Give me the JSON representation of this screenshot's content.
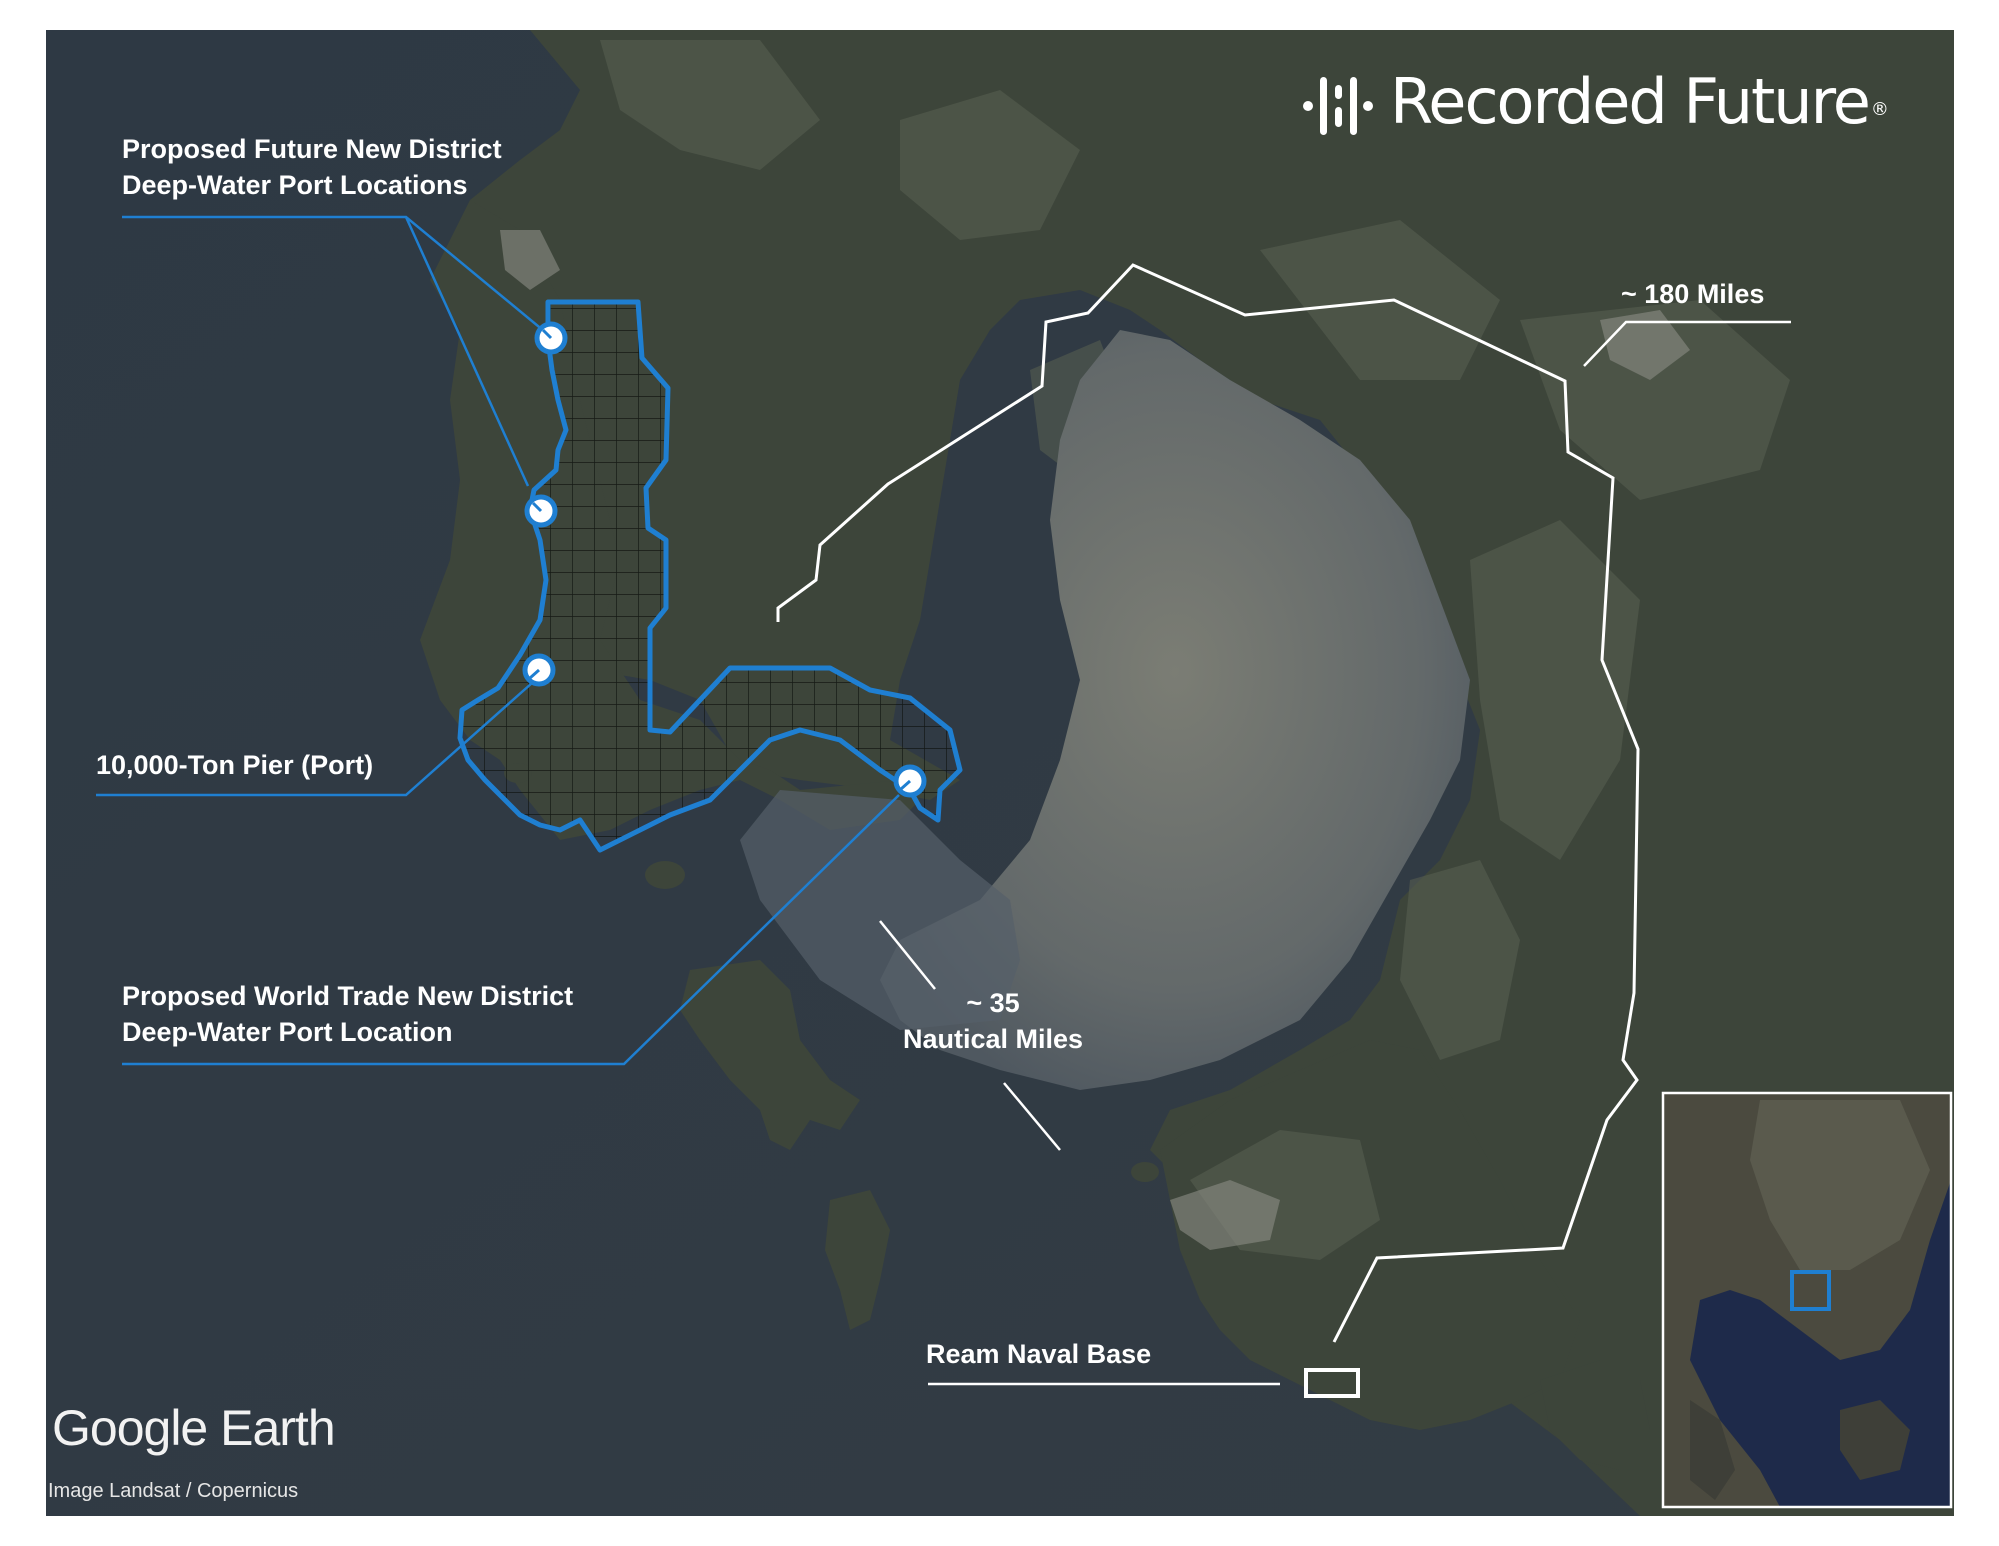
{
  "brand": {
    "name": "Recorded Future",
    "registered_mark": "®"
  },
  "labels": {
    "future_ports": [
      "Proposed Future New District",
      "Deep-Water Port Locations"
    ],
    "pier": "10,000-Ton Pier (Port)",
    "world_trade": [
      "Proposed World Trade New District",
      "Deep-Water Port Location"
    ],
    "distance_nautical": [
      "~ 35",
      "Nautical Miles"
    ],
    "distance_road": "~ 180 Miles",
    "naval_base": "Ream Naval Base"
  },
  "watermark": {
    "logo_text": "Google Earth",
    "credit": "Image Landsat / Copernicus"
  },
  "colors": {
    "accent_blue": "#1f7fd1",
    "annotation_white": "#ffffff",
    "sea": "#2f3a45",
    "land": "#3c4438",
    "bay": "#6e7570",
    "frame": "#ffffff"
  },
  "markers": [
    {
      "name": "port-location-1",
      "icon": "white-circle-marker"
    },
    {
      "name": "port-location-2",
      "icon": "white-circle-marker"
    },
    {
      "name": "pier-location",
      "icon": "white-circle-marker"
    },
    {
      "name": "world-trade-port-location",
      "icon": "white-circle-marker"
    }
  ],
  "inset": {
    "description_icon": "regional-locator-inset"
  }
}
